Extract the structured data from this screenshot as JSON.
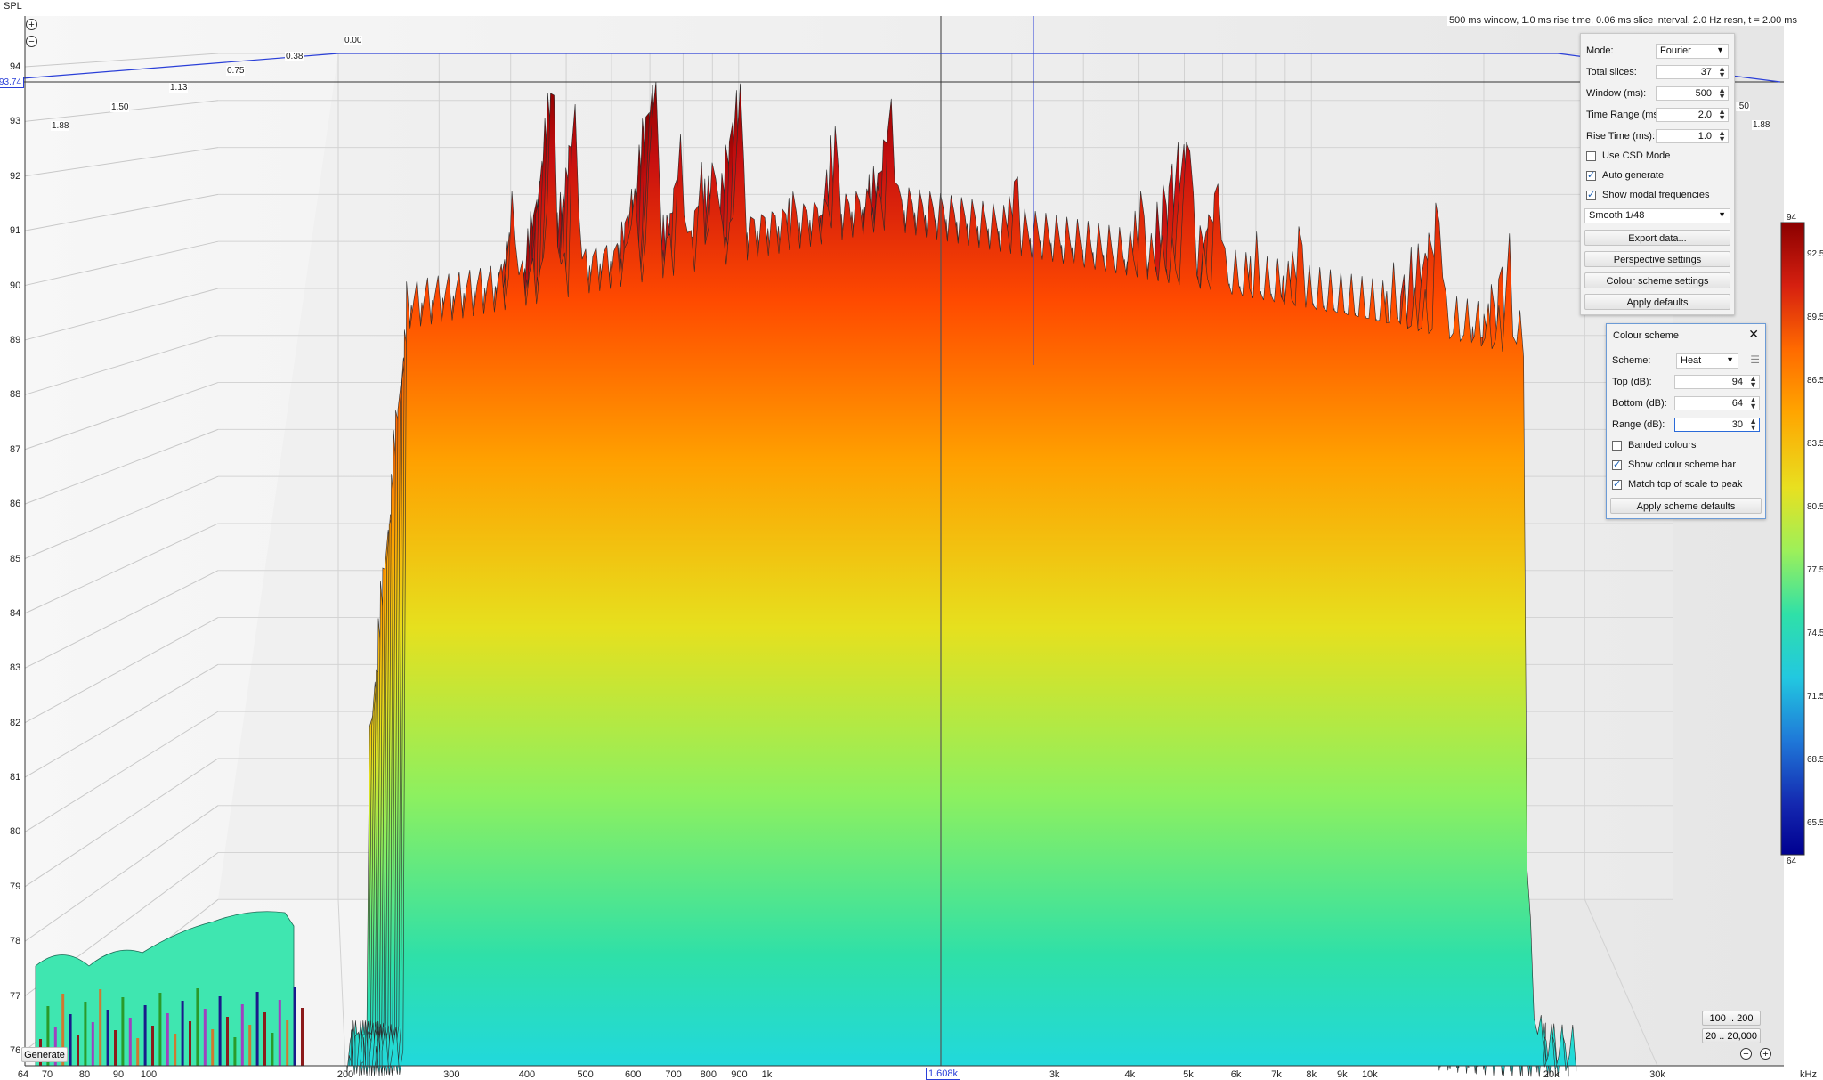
{
  "window": {
    "spl_label": "SPL",
    "info_text": "500 ms window, 1.0 ms rise time, 0.06 ms slice interval, 2.0 Hz resn, t = 2.00 ms",
    "khz_label": "kHz"
  },
  "chart_data": {
    "type": "waterfall",
    "title": "",
    "ylabel": "SPL",
    "xlabel": "kHz",
    "x_scale": "log",
    "y_ticks": [
      "76",
      "77",
      "78",
      "79",
      "80",
      "81",
      "82",
      "83",
      "84",
      "85",
      "86",
      "87",
      "88",
      "89",
      "90",
      "91",
      "92",
      "93",
      "94"
    ],
    "x_ticks": [
      "64",
      "70",
      "80",
      "90",
      "100",
      "200",
      "300",
      "400",
      "500",
      "600",
      "700",
      "800",
      "900",
      "1k",
      "2k",
      "3k",
      "4k",
      "5k",
      "6k",
      "7k",
      "8k",
      "9k",
      "10k",
      "20k",
      "30k"
    ],
    "time_ticks_left": [
      "0.00",
      "0.38",
      "0.75",
      "1.13",
      "1.50",
      "1.88"
    ],
    "time_ticks_right": [
      "0.00",
      ".50",
      "1.88"
    ],
    "cursor_spl": "93.74",
    "cursor_freq": "1.608k",
    "ylim": [
      76,
      94
    ],
    "time_range_ms": [
      0,
      2.0
    ],
    "peak_freqs": [
      380,
      440,
      480,
      600,
      650,
      720,
      780,
      820,
      900,
      1100,
      1300,
      1608,
      2100,
      2600,
      3300,
      4200,
      5000,
      5600,
      6500,
      7700,
      9000,
      11000,
      13000,
      17000
    ],
    "peak_spl": [
      91.5,
      93.5,
      93.0,
      91.8,
      93.8,
      92.5,
      92.0,
      92.5,
      93.5,
      91.5,
      92.6,
      93.3,
      90.8,
      92.0,
      89.8,
      91.5,
      93.0,
      92.0,
      90.5,
      91.0,
      88.5,
      90.0,
      91.5,
      90.5
    ]
  },
  "colour_bar": {
    "top": "94",
    "bottom": "64",
    "ticks": [
      "92.5",
      "89.5",
      "86.5",
      "83.5",
      "80.5",
      "77.5",
      "74.5",
      "71.5",
      "68.5",
      "65.5"
    ],
    "colors": [
      "#8b0000",
      "#d62010",
      "#ff6a00",
      "#ffa500",
      "#e8e020",
      "#9cf05a",
      "#2fe0a8",
      "#22c8e0",
      "#1f78d8",
      "#1428b0",
      "#000090"
    ]
  },
  "settings_panel": {
    "mode_label": "Mode:",
    "mode_value": "Fourier",
    "total_slices_label": "Total slices:",
    "total_slices_value": "37",
    "window_label": "Window (ms):",
    "window_value": "500",
    "time_range_label": "Time Range (ms):",
    "time_range_value": "2.0",
    "rise_time_label": "Rise Time (ms):",
    "rise_time_value": "1.0",
    "use_csd_label": "Use CSD Mode",
    "auto_generate_label": "Auto generate",
    "show_modal_label": "Show modal frequencies",
    "smooth_value": "Smooth 1/48",
    "export_label": "Export data...",
    "perspective_label": "Perspective settings",
    "colour_scheme_settings_label": "Colour scheme settings",
    "apply_defaults_label": "Apply defaults"
  },
  "colour_scheme_panel": {
    "title": "Colour scheme",
    "scheme_label": "Scheme:",
    "scheme_value": "Heat",
    "top_label": "Top (dB):",
    "top_value": "94",
    "bottom_label": "Bottom (dB):",
    "bottom_value": "64",
    "range_label": "Range (dB):",
    "range_value": "30",
    "banded_label": "Banded colours",
    "show_bar_label": "Show colour scheme bar",
    "match_top_label": "Match top of scale to peak",
    "apply_scheme_defaults_label": "Apply scheme defaults"
  },
  "bottom_controls": {
    "generate_label": "Generate",
    "range_100_200": "100 .. 200",
    "range_20_20000": "20 .. 20,000"
  }
}
